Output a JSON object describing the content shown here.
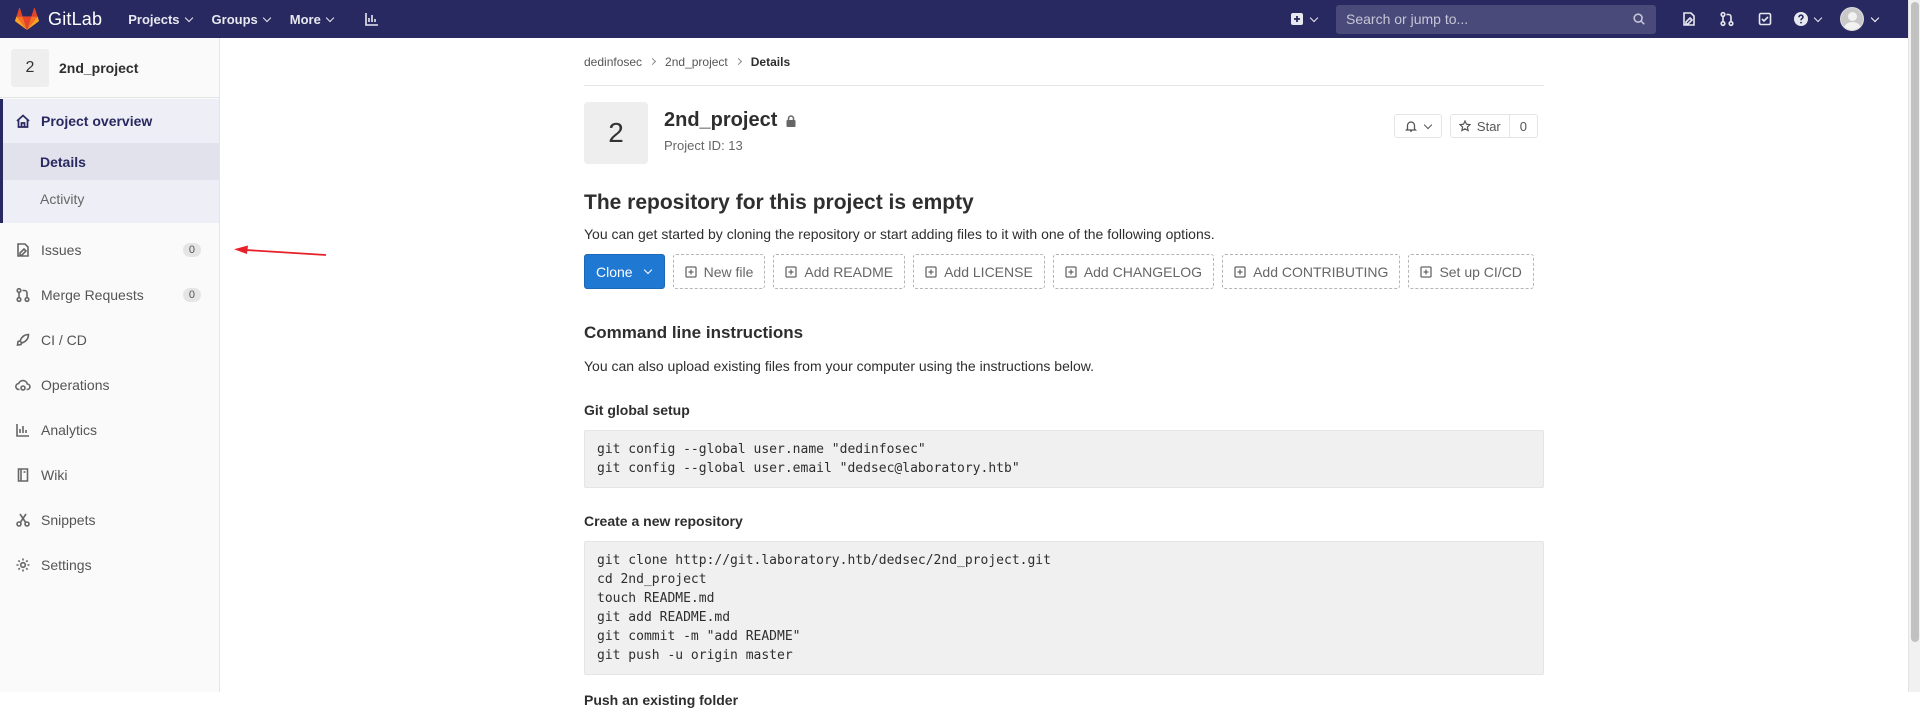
{
  "navbar": {
    "brand": "GitLab",
    "links": [
      {
        "label": "Projects"
      },
      {
        "label": "Groups"
      },
      {
        "label": "More"
      }
    ],
    "search_placeholder": "Search or jump to..."
  },
  "sidebar": {
    "project_avatar": "2",
    "project_name": "2nd_project",
    "overview_label": "Project overview",
    "sub_items": [
      "Details",
      "Activity"
    ],
    "issues_label": "Issues",
    "issues_count": "0",
    "mr_label": "Merge Requests",
    "mr_count": "0",
    "cicd_label": "CI / CD",
    "operations_label": "Operations",
    "analytics_label": "Analytics",
    "wiki_label": "Wiki",
    "snippets_label": "Snippets",
    "settings_label": "Settings"
  },
  "breadcrumb": [
    "dedinfosec",
    "2nd_project",
    "Details"
  ],
  "project": {
    "avatar": "2",
    "name": "2nd_project",
    "id_text": "Project ID: 13",
    "star_label": "Star",
    "star_count": "0"
  },
  "empty_repo": {
    "title": "The repository for this project is empty",
    "description": "You can get started by cloning the repository or start adding files to it with one of the following options.",
    "clone_label": "Clone",
    "buttons": [
      "New file",
      "Add README",
      "Add LICENSE",
      "Add CHANGELOG",
      "Add CONTRIBUTING",
      "Set up CI/CD"
    ]
  },
  "cli": {
    "title": "Command line instructions",
    "description": "You can also upload existing files from your computer using the instructions below.",
    "global_setup_title": "Git global setup",
    "global_setup_code": "git config --global user.name \"dedinfosec\"\ngit config --global user.email \"dedsec@laboratory.htb\"",
    "new_repo_title": "Create a new repository",
    "new_repo_code": "git clone http://git.laboratory.htb/dedsec/2nd_project.git\ncd 2nd_project\ntouch README.md\ngit add README.md\ngit commit -m \"add README\"\ngit push -u origin master",
    "push_folder_title": "Push an existing folder"
  },
  "colors": {
    "navbar_bg": "#292961",
    "primary_button": "#1f78d1",
    "annotation_arrow": "#e8202a"
  }
}
